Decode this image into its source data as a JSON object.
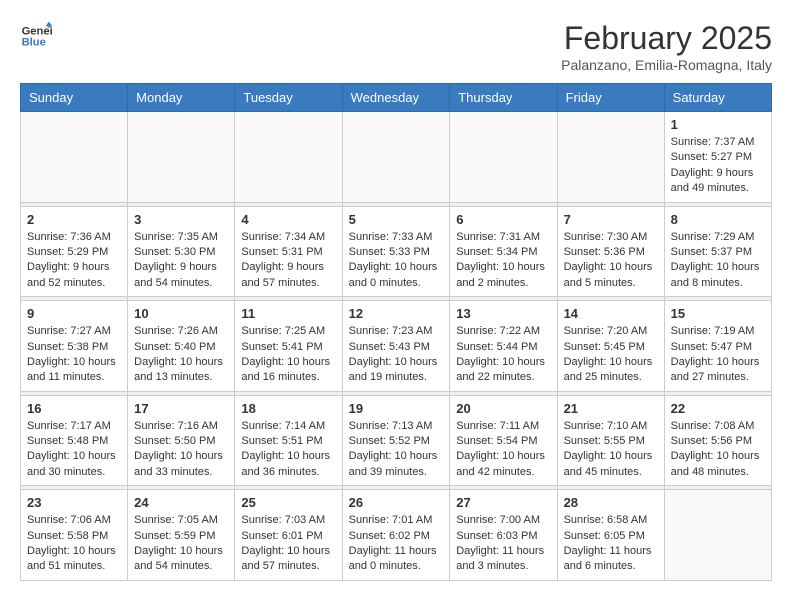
{
  "header": {
    "logo_line1": "General",
    "logo_line2": "Blue",
    "month": "February 2025",
    "location": "Palanzano, Emilia-Romagna, Italy"
  },
  "weekdays": [
    "Sunday",
    "Monday",
    "Tuesday",
    "Wednesday",
    "Thursday",
    "Friday",
    "Saturday"
  ],
  "weeks": [
    [
      {
        "day": "",
        "info": ""
      },
      {
        "day": "",
        "info": ""
      },
      {
        "day": "",
        "info": ""
      },
      {
        "day": "",
        "info": ""
      },
      {
        "day": "",
        "info": ""
      },
      {
        "day": "",
        "info": ""
      },
      {
        "day": "1",
        "info": "Sunrise: 7:37 AM\nSunset: 5:27 PM\nDaylight: 9 hours and 49 minutes."
      }
    ],
    [
      {
        "day": "2",
        "info": "Sunrise: 7:36 AM\nSunset: 5:29 PM\nDaylight: 9 hours and 52 minutes."
      },
      {
        "day": "3",
        "info": "Sunrise: 7:35 AM\nSunset: 5:30 PM\nDaylight: 9 hours and 54 minutes."
      },
      {
        "day": "4",
        "info": "Sunrise: 7:34 AM\nSunset: 5:31 PM\nDaylight: 9 hours and 57 minutes."
      },
      {
        "day": "5",
        "info": "Sunrise: 7:33 AM\nSunset: 5:33 PM\nDaylight: 10 hours and 0 minutes."
      },
      {
        "day": "6",
        "info": "Sunrise: 7:31 AM\nSunset: 5:34 PM\nDaylight: 10 hours and 2 minutes."
      },
      {
        "day": "7",
        "info": "Sunrise: 7:30 AM\nSunset: 5:36 PM\nDaylight: 10 hours and 5 minutes."
      },
      {
        "day": "8",
        "info": "Sunrise: 7:29 AM\nSunset: 5:37 PM\nDaylight: 10 hours and 8 minutes."
      }
    ],
    [
      {
        "day": "9",
        "info": "Sunrise: 7:27 AM\nSunset: 5:38 PM\nDaylight: 10 hours and 11 minutes."
      },
      {
        "day": "10",
        "info": "Sunrise: 7:26 AM\nSunset: 5:40 PM\nDaylight: 10 hours and 13 minutes."
      },
      {
        "day": "11",
        "info": "Sunrise: 7:25 AM\nSunset: 5:41 PM\nDaylight: 10 hours and 16 minutes."
      },
      {
        "day": "12",
        "info": "Sunrise: 7:23 AM\nSunset: 5:43 PM\nDaylight: 10 hours and 19 minutes."
      },
      {
        "day": "13",
        "info": "Sunrise: 7:22 AM\nSunset: 5:44 PM\nDaylight: 10 hours and 22 minutes."
      },
      {
        "day": "14",
        "info": "Sunrise: 7:20 AM\nSunset: 5:45 PM\nDaylight: 10 hours and 25 minutes."
      },
      {
        "day": "15",
        "info": "Sunrise: 7:19 AM\nSunset: 5:47 PM\nDaylight: 10 hours and 27 minutes."
      }
    ],
    [
      {
        "day": "16",
        "info": "Sunrise: 7:17 AM\nSunset: 5:48 PM\nDaylight: 10 hours and 30 minutes."
      },
      {
        "day": "17",
        "info": "Sunrise: 7:16 AM\nSunset: 5:50 PM\nDaylight: 10 hours and 33 minutes."
      },
      {
        "day": "18",
        "info": "Sunrise: 7:14 AM\nSunset: 5:51 PM\nDaylight: 10 hours and 36 minutes."
      },
      {
        "day": "19",
        "info": "Sunrise: 7:13 AM\nSunset: 5:52 PM\nDaylight: 10 hours and 39 minutes."
      },
      {
        "day": "20",
        "info": "Sunrise: 7:11 AM\nSunset: 5:54 PM\nDaylight: 10 hours and 42 minutes."
      },
      {
        "day": "21",
        "info": "Sunrise: 7:10 AM\nSunset: 5:55 PM\nDaylight: 10 hours and 45 minutes."
      },
      {
        "day": "22",
        "info": "Sunrise: 7:08 AM\nSunset: 5:56 PM\nDaylight: 10 hours and 48 minutes."
      }
    ],
    [
      {
        "day": "23",
        "info": "Sunrise: 7:06 AM\nSunset: 5:58 PM\nDaylight: 10 hours and 51 minutes."
      },
      {
        "day": "24",
        "info": "Sunrise: 7:05 AM\nSunset: 5:59 PM\nDaylight: 10 hours and 54 minutes."
      },
      {
        "day": "25",
        "info": "Sunrise: 7:03 AM\nSunset: 6:01 PM\nDaylight: 10 hours and 57 minutes."
      },
      {
        "day": "26",
        "info": "Sunrise: 7:01 AM\nSunset: 6:02 PM\nDaylight: 11 hours and 0 minutes."
      },
      {
        "day": "27",
        "info": "Sunrise: 7:00 AM\nSunset: 6:03 PM\nDaylight: 11 hours and 3 minutes."
      },
      {
        "day": "28",
        "info": "Sunrise: 6:58 AM\nSunset: 6:05 PM\nDaylight: 11 hours and 6 minutes."
      },
      {
        "day": "",
        "info": ""
      }
    ]
  ]
}
